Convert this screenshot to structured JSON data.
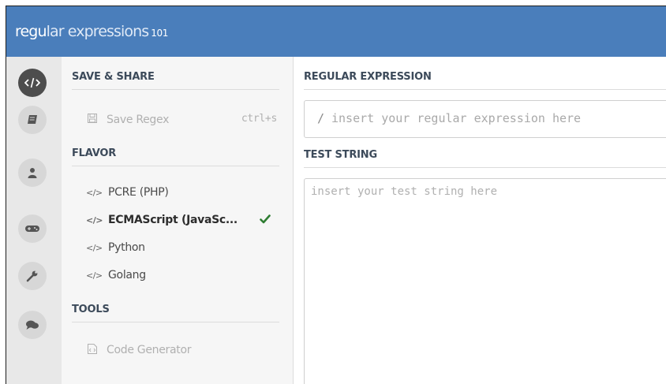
{
  "app": {
    "brand_part1": "regu",
    "brand_part2": "lar expressions",
    "brand_part3": "101"
  },
  "rail": {
    "items": [
      {
        "icon": "code-icon",
        "active": true
      },
      {
        "icon": "library-icon",
        "active": false
      },
      {
        "icon": "user-icon",
        "active": false
      },
      {
        "icon": "gamepad-icon",
        "active": false
      },
      {
        "icon": "wrench-icon",
        "active": false
      },
      {
        "icon": "chat-icon",
        "active": false
      }
    ]
  },
  "sidebar": {
    "save_share_title": "SAVE & SHARE",
    "save_regex_label": "Save Regex",
    "save_regex_shortcut": "ctrl+s",
    "flavor_title": "FLAVOR",
    "flavors": [
      {
        "tag": "</>",
        "label": "PCRE (PHP)",
        "selected": false
      },
      {
        "tag": "</>",
        "label": "ECMAScript (JavaSc...",
        "selected": true
      },
      {
        "tag": "</>",
        "label": "Python",
        "selected": false
      },
      {
        "tag": "</>",
        "label": "Golang",
        "selected": false
      }
    ],
    "tools_title": "TOOLS",
    "code_generator_label": "Code Generator"
  },
  "main": {
    "regex_title": "REGULAR EXPRESSION",
    "regex_delimiter": "/",
    "regex_placeholder": "insert your regular expression here",
    "test_title": "TEST STRING",
    "test_placeholder": "insert your test string here"
  },
  "colors": {
    "header": "#4a7ebb",
    "rail": "#e8e8e8",
    "sidebar": "#f6f6f6",
    "check": "#2e7d32"
  }
}
